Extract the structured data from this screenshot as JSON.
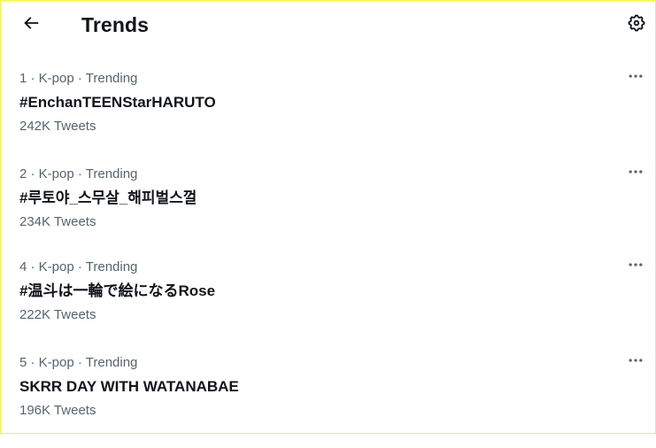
{
  "header": {
    "title": "Trends",
    "back_icon": "arrow-left-icon",
    "settings_icon": "gear-icon"
  },
  "trends": [
    {
      "context": "1 · K-pop · Trending",
      "name": "#EnchanTEENStarHARUTO",
      "count": "242K Tweets"
    },
    {
      "context": "2 · K-pop · Trending",
      "name": "#루토야_스무살_해피벌스껄",
      "count": "234K Tweets"
    },
    {
      "context": "4 · K-pop · Trending",
      "name": "#温斗は一輪で絵になるRose",
      "count": "222K Tweets"
    },
    {
      "context": "5 · K-pop · Trending",
      "name": "SKRR DAY WITH WATANABAE",
      "count": "196K Tweets"
    }
  ],
  "more_icon": "more-horizontal-icon",
  "colors": {
    "text_primary": "#0f1419",
    "text_secondary": "#536471",
    "border": "#f5f047"
  }
}
